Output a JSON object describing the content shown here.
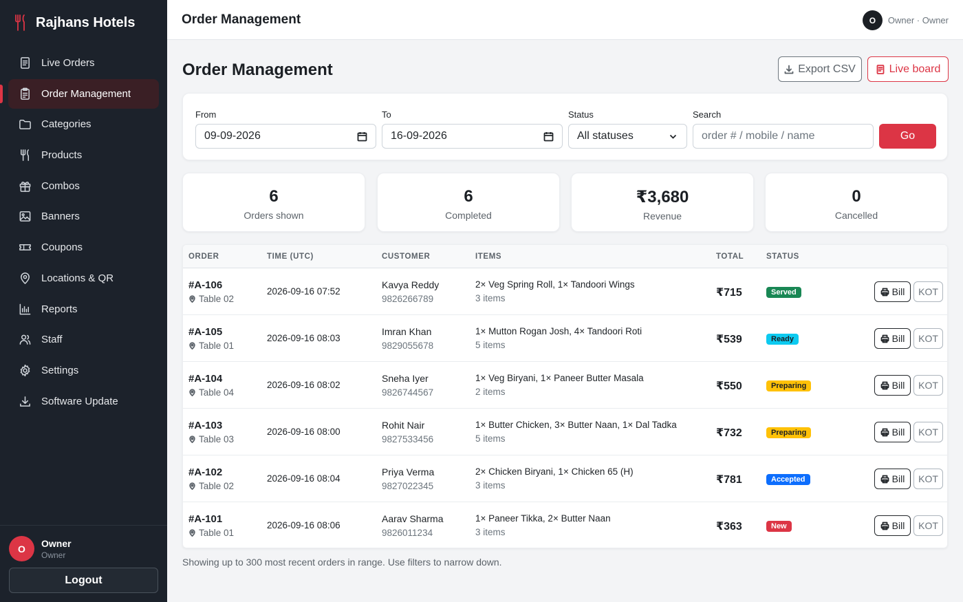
{
  "sidebar": {
    "brand": "Rajhans Hotels",
    "items": [
      {
        "label": "Live Orders",
        "icon": "document-icon"
      },
      {
        "label": "Order Management",
        "icon": "clipboard-icon",
        "active": true
      },
      {
        "label": "Categories",
        "icon": "folder-icon"
      },
      {
        "label": "Products",
        "icon": "utensils-icon"
      },
      {
        "label": "Combos",
        "icon": "gift-icon"
      },
      {
        "label": "Banners",
        "icon": "image-icon"
      },
      {
        "label": "Coupons",
        "icon": "ticket-icon"
      },
      {
        "label": "Locations & QR",
        "icon": "location-pin-icon"
      },
      {
        "label": "Reports",
        "icon": "bar-chart-icon"
      },
      {
        "label": "Staff",
        "icon": "people-icon"
      },
      {
        "label": "Settings",
        "icon": "gear-icon"
      },
      {
        "label": "Software Update",
        "icon": "download-icon"
      }
    ],
    "user": {
      "initial": "O",
      "name": "Owner",
      "role": "Owner"
    },
    "logout_label": "Logout"
  },
  "topbar": {
    "title": "Order Management",
    "avatar_initial": "O",
    "account_text": "Owner · Owner"
  },
  "main": {
    "title": "Order Management",
    "export_label": "Export CSV",
    "live_board_label": "Live board"
  },
  "filters": {
    "from_label": "From",
    "from_value": "09-09-2026",
    "to_label": "To",
    "to_value": "16-09-2026",
    "status_label": "Status",
    "status_value": "All statuses",
    "search_label": "Search",
    "search_placeholder": "order # / mobile / name",
    "go_label": "Go"
  },
  "stats": [
    {
      "value": "6",
      "label": "Orders shown"
    },
    {
      "value": "6",
      "label": "Completed"
    },
    {
      "value": "₹3,680",
      "label": "Revenue"
    },
    {
      "value": "0",
      "label": "Cancelled"
    }
  ],
  "table": {
    "headers": {
      "order": "ORDER",
      "time": "TIME (UTC)",
      "customer": "CUSTOMER",
      "items": "ITEMS",
      "total": "TOTAL",
      "status": "STATUS"
    },
    "bill_label": "Bill",
    "kot_label": "KOT",
    "rows": [
      {
        "id": "#A-106",
        "table": "Table 02",
        "time": "2026-09-16 07:52",
        "customer": "Kavya Reddy",
        "mobile": "9826266789",
        "items": "2× Veg Spring Roll, 1× Tandoori Wings",
        "count": "3 items",
        "total": "₹715",
        "status": "Served",
        "status_class": "st-served"
      },
      {
        "id": "#A-105",
        "table": "Table 01",
        "time": "2026-09-16 08:03",
        "customer": "Imran Khan",
        "mobile": "9829055678",
        "items": "1× Mutton Rogan Josh, 4× Tandoori Roti",
        "count": "5 items",
        "total": "₹539",
        "status": "Ready",
        "status_class": "st-ready"
      },
      {
        "id": "#A-104",
        "table": "Table 04",
        "time": "2026-09-16 08:02",
        "customer": "Sneha Iyer",
        "mobile": "9826744567",
        "items": "1× Veg Biryani, 1× Paneer Butter Masala",
        "count": "2 items",
        "total": "₹550",
        "status": "Preparing",
        "status_class": "st-preparing"
      },
      {
        "id": "#A-103",
        "table": "Table 03",
        "time": "2026-09-16 08:00",
        "customer": "Rohit Nair",
        "mobile": "9827533456",
        "items": "1× Butter Chicken, 3× Butter Naan, 1× Dal Tadka",
        "count": "5 items",
        "total": "₹732",
        "status": "Preparing",
        "status_class": "st-preparing"
      },
      {
        "id": "#A-102",
        "table": "Table 02",
        "time": "2026-09-16 08:04",
        "customer": "Priya Verma",
        "mobile": "9827022345",
        "items": "2× Chicken Biryani, 1× Chicken 65 (H)",
        "count": "3 items",
        "total": "₹781",
        "status": "Accepted",
        "status_class": "st-accepted"
      },
      {
        "id": "#A-101",
        "table": "Table 01",
        "time": "2026-09-16 08:06",
        "customer": "Aarav Sharma",
        "mobile": "9826011234",
        "items": "1× Paneer Tikka, 2× Butter Naan",
        "count": "3 items",
        "total": "₹363",
        "status": "New",
        "status_class": "st-new"
      }
    ]
  },
  "footnote": "Showing up to 300 most recent orders in range. Use filters to narrow down."
}
